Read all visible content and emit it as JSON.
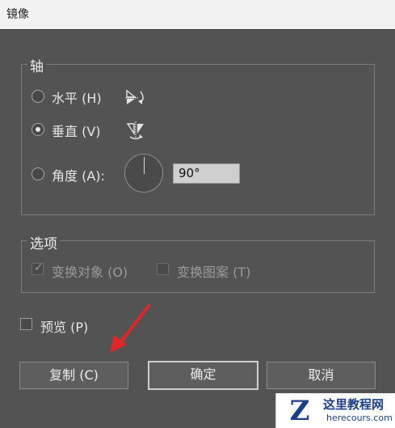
{
  "window": {
    "title": "镜像"
  },
  "axis_group": {
    "legend": "轴",
    "horizontal": {
      "label": "水平 (H)",
      "selected": false
    },
    "vertical": {
      "label": "垂直 (V)",
      "selected": true
    },
    "angle": {
      "label": "角度 (A):",
      "selected": false,
      "value": "90°"
    }
  },
  "options_group": {
    "legend": "选项",
    "transform_objects": {
      "label": "变换对象 (O)",
      "checked": true,
      "enabled": false
    },
    "transform_patterns": {
      "label": "变换图案 (T)",
      "checked": false,
      "enabled": false
    }
  },
  "preview": {
    "label": "预览 (P)",
    "checked": false
  },
  "buttons": {
    "copy": "复制 (C)",
    "ok": "确定",
    "cancel": "取消"
  },
  "annotation": {
    "color": "#e0262a"
  },
  "watermark": {
    "title": "这里教程网",
    "url": "herecours.com"
  }
}
